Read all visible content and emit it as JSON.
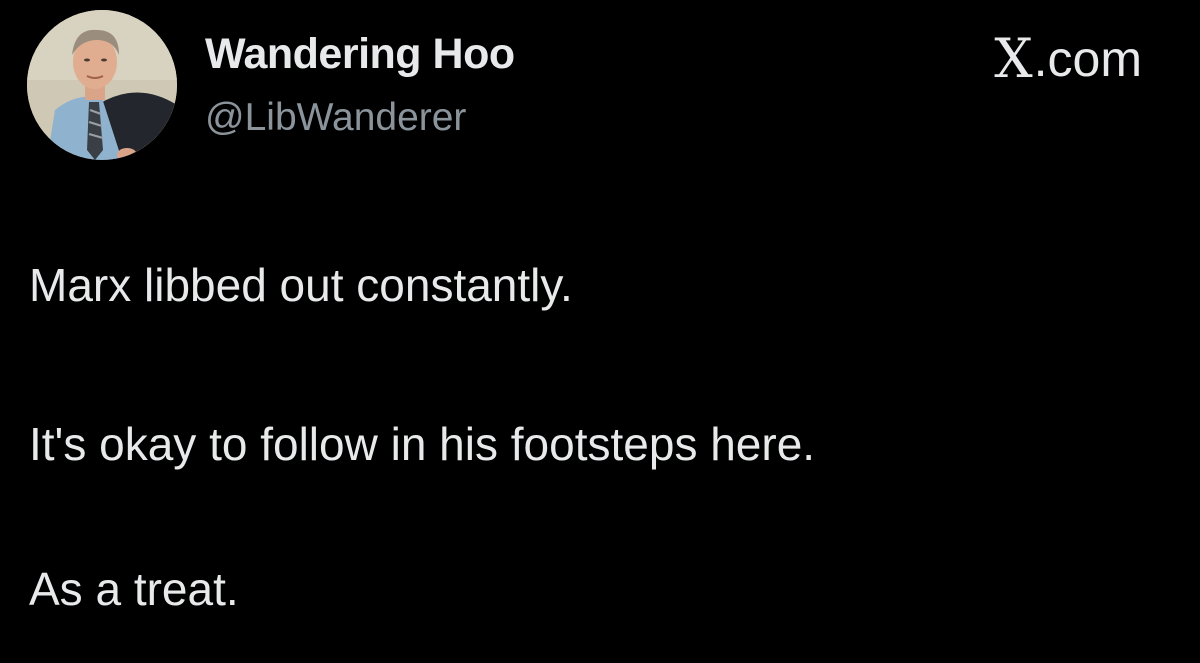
{
  "tweet": {
    "author": {
      "display_name": "Wandering Hoo",
      "handle": "@LibWanderer",
      "avatar_icon": "portrait-painting"
    },
    "source": {
      "brand_mark": "X",
      "brand_domain": ".com"
    },
    "body_lines": [
      "Marx libbed out constantly.",
      "It's okay to follow in his footsteps here.",
      "As a treat."
    ]
  },
  "colors": {
    "background": "#000000",
    "primary_text": "#e7e9ea",
    "secondary_text": "#8b949a"
  }
}
